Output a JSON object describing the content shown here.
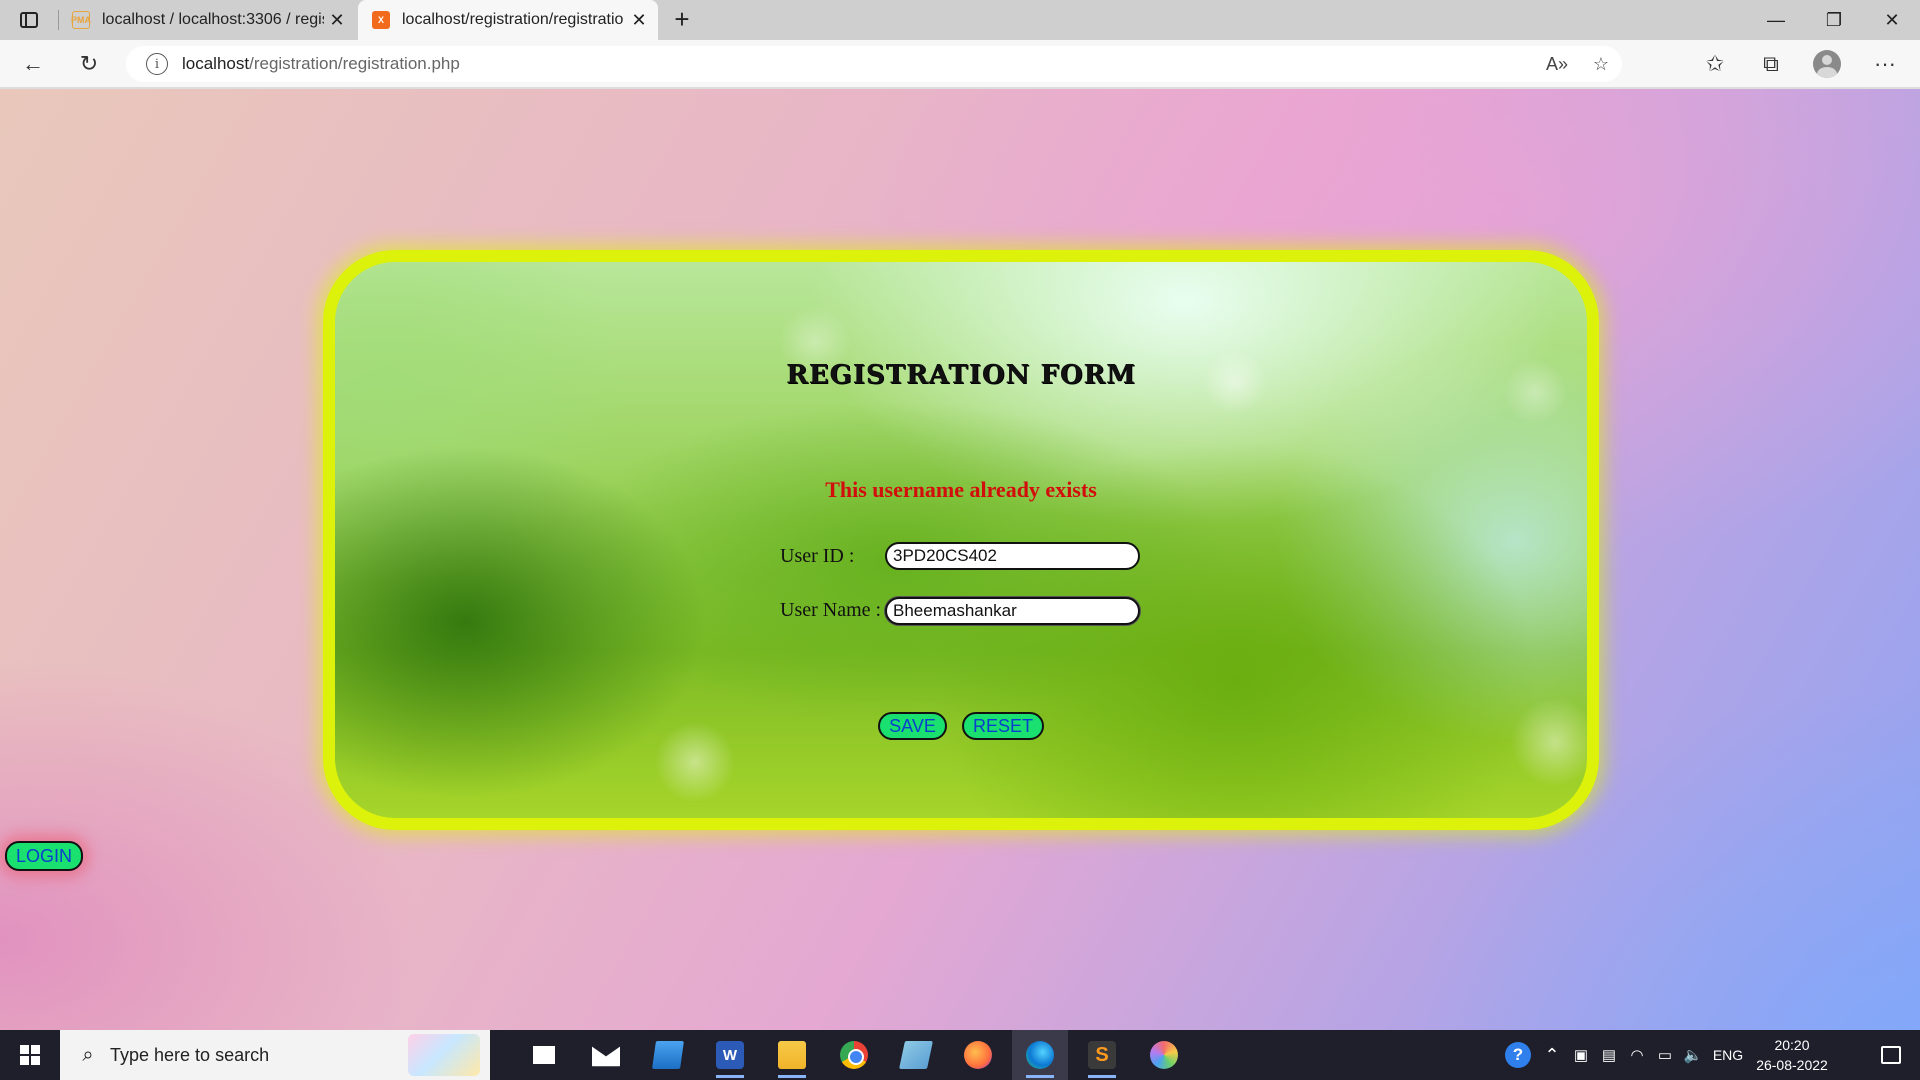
{
  "browser": {
    "tabs": [
      {
        "label": "localhost / localhost:3306 / regis",
        "favicon": "phpmyadmin-icon",
        "active": false
      },
      {
        "label": "localhost/registration/registratio",
        "favicon": "xampp-icon",
        "active": true
      }
    ],
    "favicon_text": {
      "pma": "PMA",
      "xampp": "X"
    },
    "address": {
      "host": "localhost",
      "path": "/registration/registration.php"
    },
    "icons": {
      "tab_close": "✕",
      "new_tab": "+",
      "minimize": "—",
      "maximize": "❐",
      "close": "✕",
      "back": "←",
      "reload": "↻",
      "info": "i",
      "read_aloud": "A»",
      "add_favorite": "☆",
      "favorites": "✩",
      "collections": "⧉",
      "more": "···"
    }
  },
  "form": {
    "title": "REGISTRATION FORM",
    "error": "This username already exists",
    "user_id_label": "User ID :",
    "user_id_value": "3PD20CS402",
    "user_name_label": "User Name :",
    "user_name_value": "Bheemashankar",
    "save_label": "SAVE",
    "reset_label": "RESET"
  },
  "login_label": "LOGIN",
  "taskbar": {
    "search_placeholder": "Type here to search",
    "search_icon": "⌕",
    "apps": [
      "microsoft-store",
      "mail",
      "this-pc",
      "word",
      "file-explorer",
      "chrome",
      "remote-desktop",
      "firefox",
      "edge",
      "sublime-text",
      "paint"
    ],
    "app_glyphs": {
      "word": "W",
      "sublime": "S"
    },
    "tray": {
      "help": "?",
      "chevron": "⌃",
      "language": "ENG",
      "time": "20:20",
      "date": "26-08-2022",
      "icons": {
        "meet": "▣",
        "display": "▤",
        "wifi": "◠",
        "battery": "▭",
        "volume": "🔈"
      }
    }
  },
  "colors": {
    "card_border": "#dcf20a",
    "button_bg": "#19e06e",
    "button_text": "#0a3fcf",
    "error_text": "#d30c0c"
  }
}
